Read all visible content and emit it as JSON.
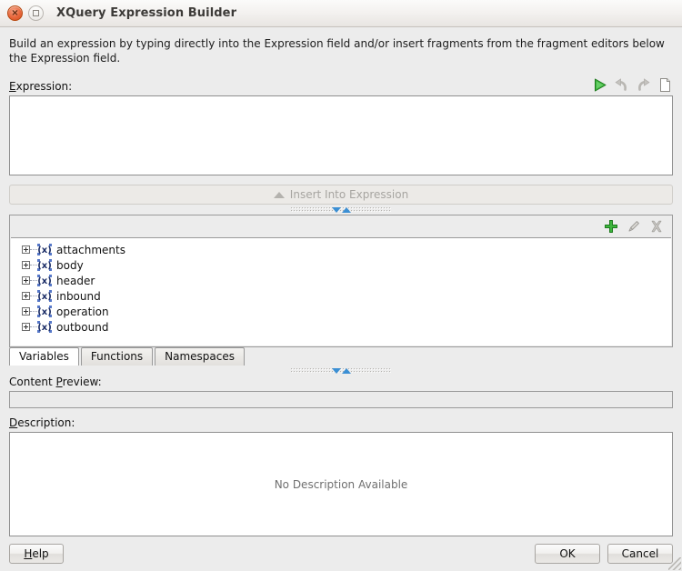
{
  "titlebar": {
    "title": "XQuery Expression Builder",
    "close_icon": "close-icon",
    "maximize_icon": "maximize-icon",
    "close_glyph": "×"
  },
  "intro": {
    "text": "Build an expression by typing directly into the Expression field and/or insert fragments from the fragment editors below the Expression field."
  },
  "expression": {
    "label": "Expression:",
    "label_mnemonic": "E",
    "label_rest": "xpression:",
    "value": "",
    "toolbar": [
      {
        "name": "run-icon",
        "title": "Run",
        "enabled": true
      },
      {
        "name": "undo-icon",
        "title": "Undo",
        "enabled": false
      },
      {
        "name": "redo-icon",
        "title": "Redo",
        "enabled": false
      },
      {
        "name": "new-document-icon",
        "title": "New",
        "enabled": true
      }
    ]
  },
  "insert_button": {
    "label": "Insert Into Expression",
    "icon": "chevron-up-icon",
    "enabled": false
  },
  "tree_panel": {
    "toolbar": [
      {
        "name": "add-icon",
        "label": "+",
        "enabled": true
      },
      {
        "name": "edit-pencil-icon",
        "label": "✎",
        "enabled": false
      },
      {
        "name": "delete-icon",
        "label": "✖",
        "enabled": false
      }
    ],
    "items": [
      {
        "label": "attachments",
        "icon": "variable-icon",
        "expanded": false
      },
      {
        "label": "body",
        "icon": "variable-icon",
        "expanded": false
      },
      {
        "label": "header",
        "icon": "variable-icon",
        "expanded": false
      },
      {
        "label": "inbound",
        "icon": "variable-icon",
        "expanded": false
      },
      {
        "label": "operation",
        "icon": "variable-icon",
        "expanded": false
      },
      {
        "label": "outbound",
        "icon": "variable-icon",
        "expanded": false
      }
    ]
  },
  "tabs": [
    {
      "label": "Variables",
      "active": true
    },
    {
      "label": "Functions",
      "active": false
    },
    {
      "label": "Namespaces",
      "active": false
    }
  ],
  "content_preview": {
    "label_pre": "Content ",
    "label_mnemonic": "P",
    "label_post": "review:",
    "value": ""
  },
  "description": {
    "label_mnemonic": "D",
    "label_post": "escription:",
    "empty_text": "No Description Available"
  },
  "footer": {
    "help": {
      "mnemonic": "H",
      "rest": "elp"
    },
    "ok_label": "OK",
    "cancel_label": "Cancel",
    "grip_icon": "resize-grip-icon"
  },
  "colors": {
    "background": "#ececec",
    "field_background": "#ffffff",
    "border": "#9a9a9a",
    "accent_green": "#2fa12f",
    "accent_blue": "#3b8fd4",
    "close_orange": "#e8663a",
    "disabled_text": "#a7a5a1"
  }
}
